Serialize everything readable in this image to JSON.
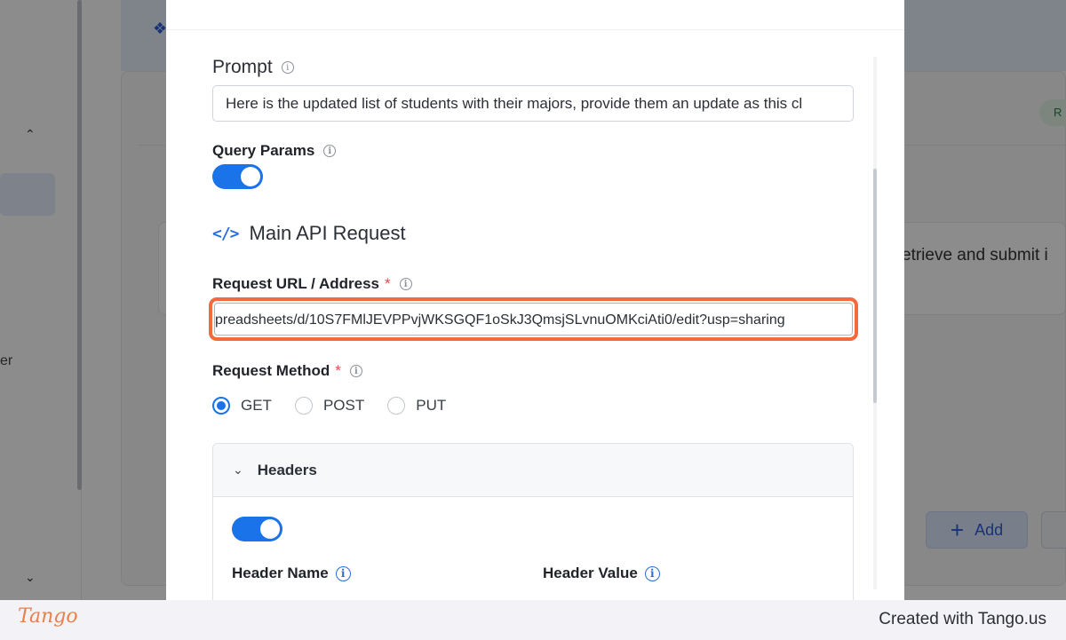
{
  "background": {
    "card_text": "etrieve and submit i",
    "pill_label": "R",
    "add_button_label": "Add",
    "sidebar_fragment": "er"
  },
  "modal": {
    "prompt": {
      "label": "Prompt",
      "value": "Here is the updated list of students with their majors, provide them an update as this cl"
    },
    "query_params": {
      "label": "Query Params",
      "enabled": true
    },
    "section_title": "Main API Request",
    "request_url": {
      "label": "Request URL / Address",
      "required_mark": "*",
      "value": "preadsheets/d/10S7FMlJEVPPvjWKSGQF1oSkJ3QmsjSLvnuOMKciAti0/edit?usp=sharing"
    },
    "request_method": {
      "label": "Request Method",
      "required_mark": "*",
      "options": [
        "GET",
        "POST",
        "PUT"
      ],
      "selected": "GET"
    },
    "headers": {
      "title": "Headers",
      "enabled": true,
      "name_label": "Header Name",
      "value_label": "Header Value"
    }
  },
  "footer": {
    "logo": "Tango",
    "text": "Created with Tango.us"
  },
  "colors": {
    "accent": "#1a73e8",
    "highlight": "#f26a3d",
    "required": "#e5484d"
  }
}
